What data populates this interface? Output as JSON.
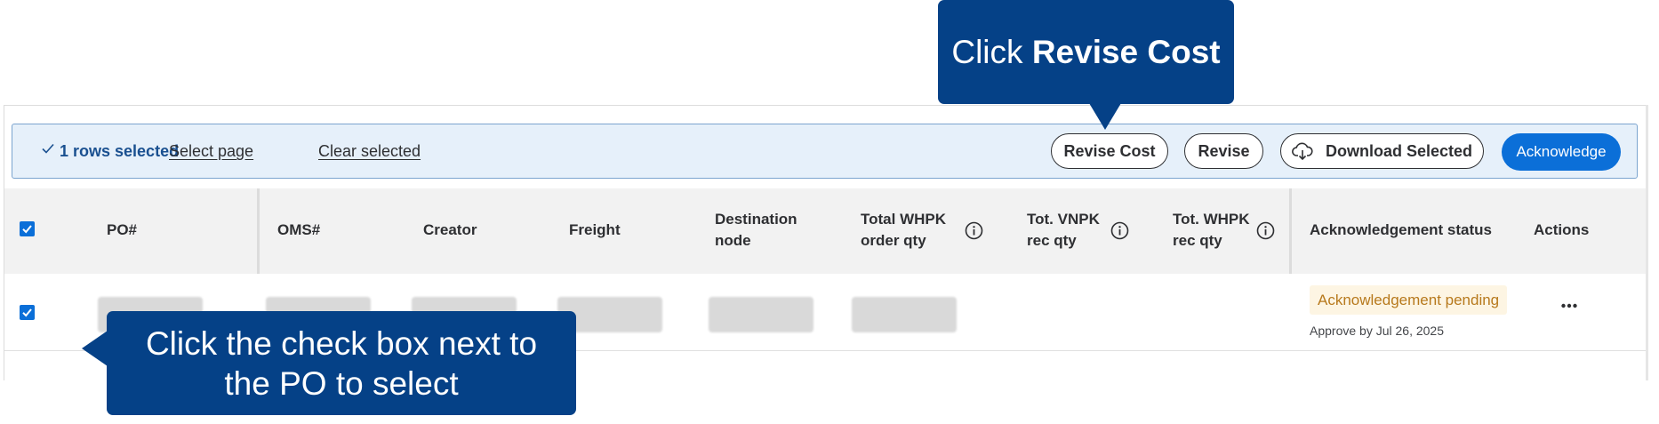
{
  "colors": {
    "callout_bg": "#054187",
    "toolbar_bg": "#e6f0fa",
    "primary": "#0b6fd8",
    "pending_text": "#b7791c",
    "pending_bg": "#fdf5e3"
  },
  "callouts": {
    "top": {
      "prefix": "Click ",
      "bold": "Revise Cost"
    },
    "bottom": {
      "line1": "Click the check box next to",
      "line2": "the PO to select"
    }
  },
  "toolbar": {
    "selected_label": "1 rows selected",
    "select_page": "Select page",
    "clear_selected": "Clear selected",
    "revise_cost": "Revise Cost",
    "revise": "Revise",
    "download_selected": "Download Selected",
    "acknowledge": "Acknowledge",
    "icons": [
      "check-icon",
      "cloud-download-icon"
    ]
  },
  "table": {
    "headers": {
      "po": "PO#",
      "oms": "OMS#",
      "creator": "Creator",
      "freight": "Freight",
      "destination_line1": "Destination",
      "destination_line2": "node",
      "total_whpk_line1": "Total WHPK",
      "total_whpk_line2": "order qty",
      "tot_vnpk_line1": "Tot. VNPK",
      "tot_vnpk_line2": "rec qty",
      "tot_whpk_line1": "Tot. WHPK",
      "tot_whpk_line2": "rec qty",
      "ack_status": "Acknowledgement status",
      "actions": "Actions"
    },
    "rows": [
      {
        "selected": true,
        "ack_status": "Acknowledgement pending",
        "approve_by": "Approve by Jul 26, 2025"
      }
    ]
  }
}
